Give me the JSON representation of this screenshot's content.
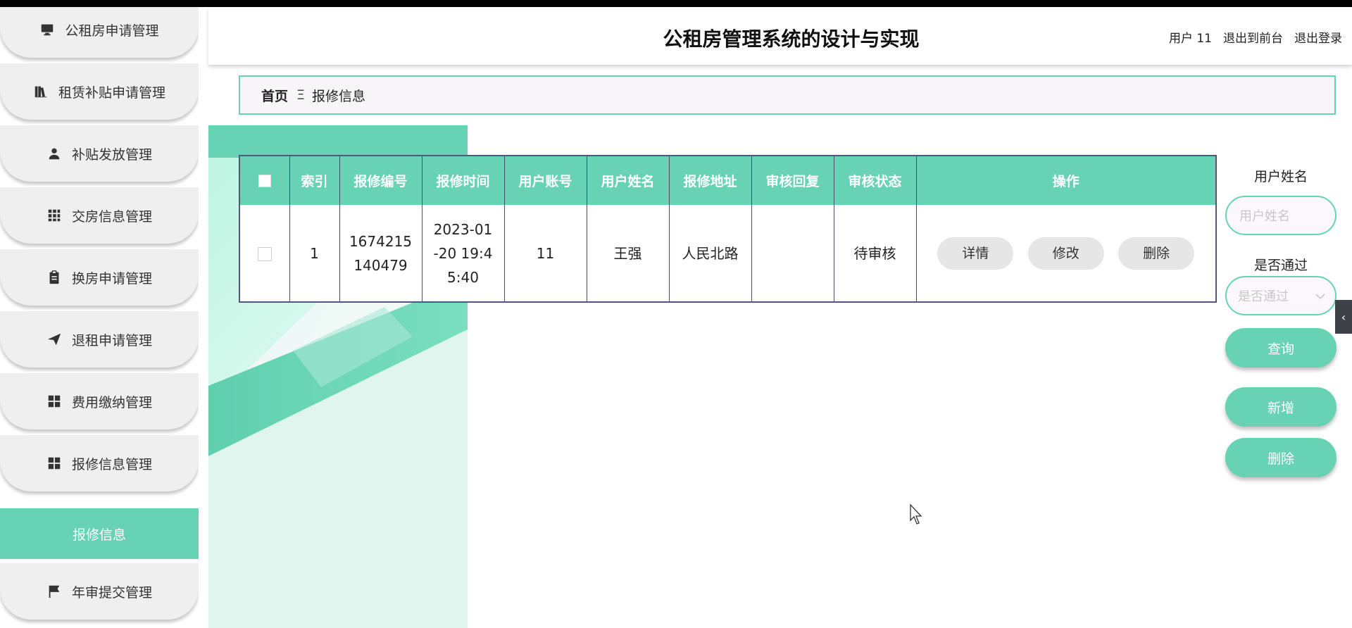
{
  "app_title": "公租房管理系统的设计与实现",
  "header": {
    "user_label": "用户 11",
    "front_link": "退出到前台",
    "logout_link": "退出登录"
  },
  "sidebar": {
    "items": [
      {
        "label": "公租房申请管理",
        "icon": "monitor-icon"
      },
      {
        "label": "租赁补贴申请管理",
        "icon": "books-icon"
      },
      {
        "label": "补贴发放管理",
        "icon": "user-icon"
      },
      {
        "label": "交房信息管理",
        "icon": "grid-icon"
      },
      {
        "label": "换房申请管理",
        "icon": "clipboard-icon"
      },
      {
        "label": "退租申请管理",
        "icon": "send-icon"
      },
      {
        "label": "费用缴纳管理",
        "icon": "apps-icon"
      },
      {
        "label": "报修信息管理",
        "icon": "apps-icon"
      }
    ],
    "active_sub": "报修信息",
    "last_item": {
      "label": "年审提交管理",
      "icon": "flag-icon"
    }
  },
  "breadcrumb": {
    "home": "首页",
    "separator": "Ξ",
    "current": "报修信息"
  },
  "table": {
    "columns": [
      "索引",
      "报修编号",
      "报修时间",
      "用户账号",
      "用户姓名",
      "报修地址",
      "审核回复",
      "审核状态",
      "操作"
    ],
    "rows": [
      {
        "index": "1",
        "repair_no": "1674215140479",
        "repair_time": "2023-01-20 19:45:40",
        "account": "11",
        "name": "王强",
        "address": "人民北路",
        "reply": "",
        "status": "待审核"
      }
    ],
    "actions": {
      "detail": "详情",
      "edit": "修改",
      "delete": "删除"
    }
  },
  "search": {
    "name_label": "用户姓名",
    "name_placeholder": "用户姓名",
    "pass_label": "是否通过",
    "pass_placeholder": "是否通过",
    "query_btn": "查询",
    "add_btn": "新增",
    "delete_btn": "删除"
  },
  "colors": {
    "accent": "#67d3b4",
    "nav_bg": "#efefef",
    "table_border": "#55557a"
  }
}
